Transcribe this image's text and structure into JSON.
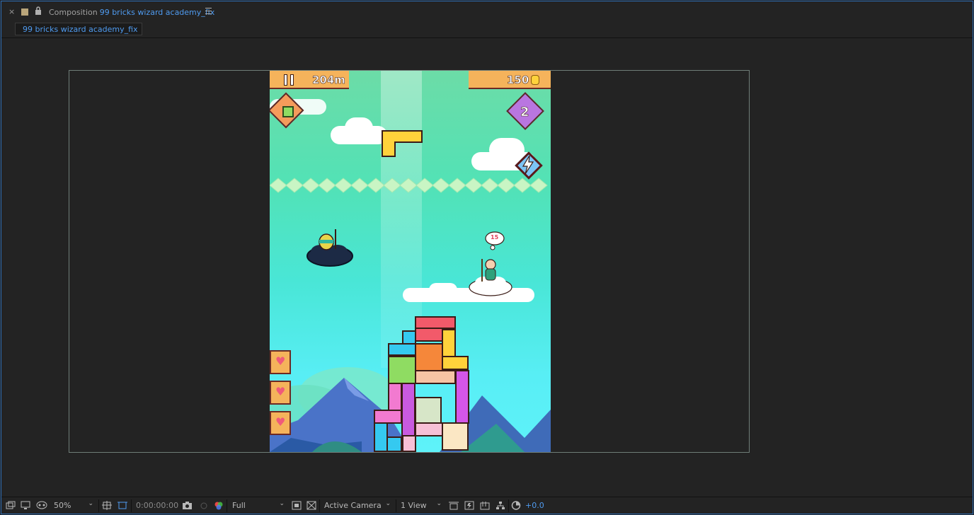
{
  "header": {
    "close_glyph": "×",
    "panel_label": "Composition",
    "comp_name": "99 bricks wizard academy_fix",
    "swatch_color": "#b9a57a"
  },
  "tabs": [
    {
      "label": "99 bricks wizard academy_fix"
    }
  ],
  "viewer": {
    "game": {
      "distance": "204m",
      "coins": "150",
      "level_badge": "2",
      "thought_bubble": "15"
    }
  },
  "footer": {
    "zoom": "50%",
    "timecode": "0:00:00:00",
    "resolution": "Full",
    "camera": "Active Camera",
    "views": "1 View",
    "exposure": "+0.0"
  },
  "colors": {
    "accent_blue": "#4f9bf0",
    "panel_bg": "#232323"
  }
}
